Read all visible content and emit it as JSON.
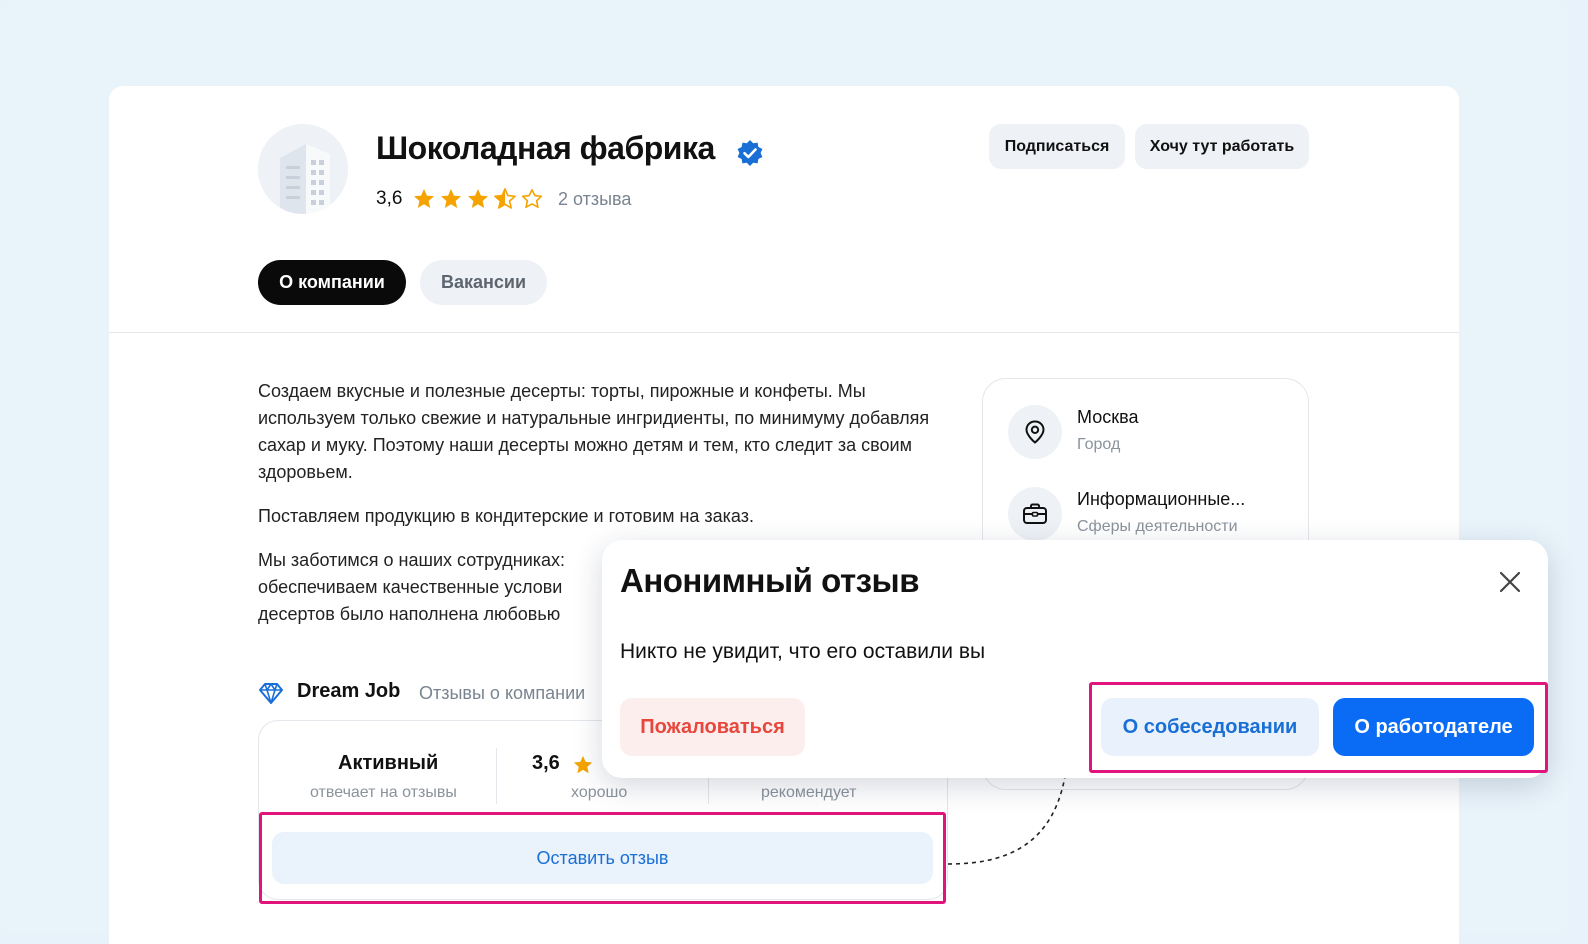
{
  "company": {
    "name": "Шоколадная фабрика",
    "rating": "3,6",
    "stars": 3.5,
    "reviews": "2 отзыва"
  },
  "header_actions": {
    "subscribe": "Подписаться",
    "want_to_work": "Хочу тут работать"
  },
  "tabs": [
    {
      "label": "О компании",
      "active": true
    },
    {
      "label": "Вакансии",
      "active": false
    }
  ],
  "description": [
    "Создаем вкусные и полезные десерты: торты, пирожные и конфеты. Мы используем только свежие и натуральные ингридиенты, по минимуму добавляя сахар и муку. Поэтому наши десерты можно детям и тем, кто следит за своим здоровьем.",
    "Поставляем продукцию в кондитерские и готовим на заказ.",
    "Мы заботимся о наших сотрудниках: обеспечиваем качественные услови десертов было наполнена любовью"
  ],
  "info": {
    "city": {
      "title": "Москва",
      "sub": "Город"
    },
    "industry": {
      "title": "Информационные...",
      "sub": "Сферы деятельности"
    }
  },
  "dream_job": {
    "name": "Dream Job",
    "sub": "Отзывы о компании",
    "stats": [
      {
        "value": "Активный",
        "sub": "отвечает на отзывы"
      },
      {
        "value": "3,6",
        "sub": "хорошо"
      },
      {
        "value": "",
        "sub": "рекомендует"
      }
    ],
    "leave_review": "Оставить отзыв"
  },
  "modal": {
    "title": "Анонимный отзыв",
    "text": "Никто не увидит, что его оставили вы",
    "complain": "Пожаловаться",
    "about_interview": "О собеседовании",
    "about_employer": "О работодателе"
  },
  "colors": {
    "accent": "#0a6cf5",
    "star": "#f5a300",
    "highlight": "#e0147c",
    "danger": "#e8473d"
  }
}
